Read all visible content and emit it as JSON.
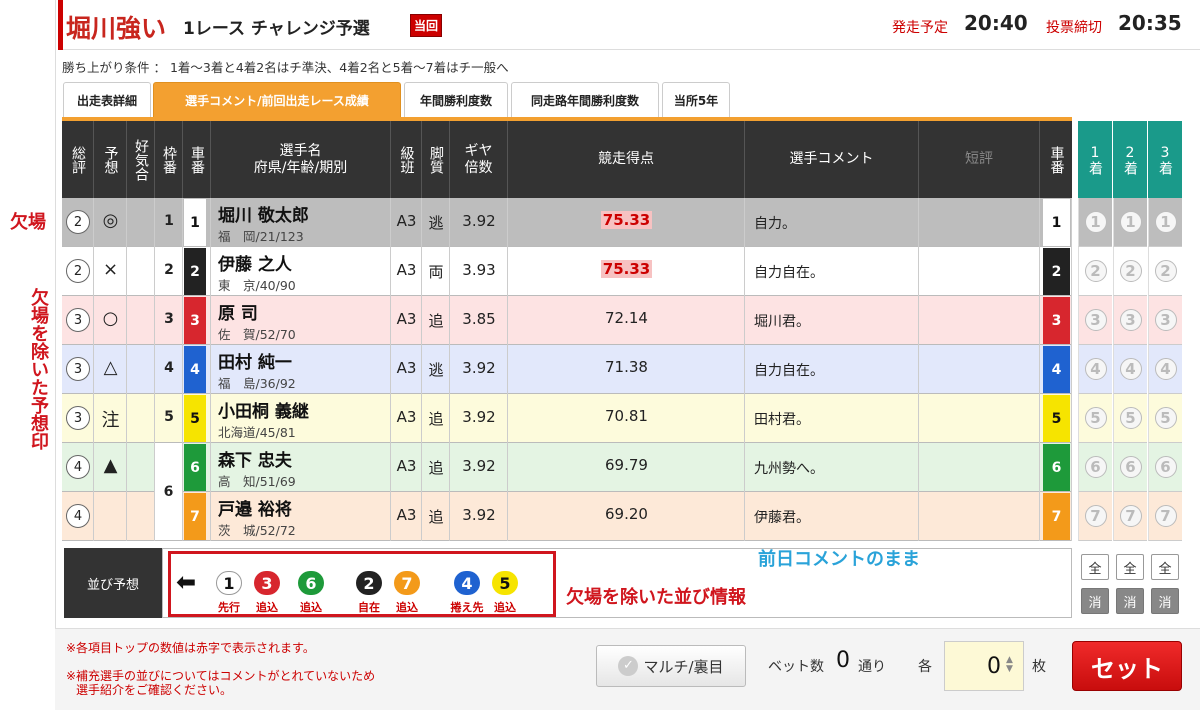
{
  "header": {
    "race_title": "堀川強い",
    "race_sub": "1レース チャレンジ予選",
    "today_badge": "当回",
    "start_label": "発走予定",
    "start_time": "20:40",
    "close_label": "投票締切",
    "close_time": "20:35"
  },
  "condition": "勝ち上がり条件 ： 1着〜3着と4着2名はチ準決、4着2名と5着〜7着はチ一般へ",
  "tabs": [
    "出走表詳細",
    "選手コメント/前回出走レース成績",
    "年間勝利度数",
    "同走路年間勝利度数",
    "当所5年"
  ],
  "columns": {
    "total": "総評",
    "yoso": "予想",
    "kouki": "好気合",
    "waku": "枠番",
    "sha": "車番",
    "name1": "選手名",
    "name2": "府県/年齢/期別",
    "kyu": "級班",
    "kyaku": "脚質",
    "gear1": "ギヤ",
    "gear2": "倍数",
    "score": "競走得点",
    "comment": "選手コメント",
    "tanpyo": "短評",
    "sha2": "車番",
    "r1": "1着",
    "r2": "2着",
    "r3": "3着"
  },
  "rows": [
    {
      "rank": "2",
      "mark": "◎",
      "waku": "1",
      "car": "1",
      "name": "堀川 敬太郎",
      "info": "福　岡/21/123",
      "cls": "A3",
      "leg": "逃",
      "gear": "3.92",
      "score": "75.33",
      "comment": "自力。"
    },
    {
      "rank": "2",
      "mark": "×",
      "waku": "2",
      "car": "2",
      "name": "伊藤 之人",
      "info": "東　京/40/90",
      "cls": "A3",
      "leg": "両",
      "gear": "3.93",
      "score": "75.33",
      "comment": "自力自在。"
    },
    {
      "rank": "3",
      "mark": "○",
      "waku": "3",
      "car": "3",
      "name": "原 司",
      "info": "佐　賀/52/70",
      "cls": "A3",
      "leg": "追",
      "gear": "3.85",
      "score": "72.14",
      "comment": "堀川君。"
    },
    {
      "rank": "3",
      "mark": "△",
      "waku": "4",
      "car": "4",
      "name": "田村 純一",
      "info": "福　島/36/92",
      "cls": "A3",
      "leg": "逃",
      "gear": "3.92",
      "score": "71.38",
      "comment": "自力自在。"
    },
    {
      "rank": "3",
      "mark": "注",
      "waku": "5",
      "car": "5",
      "name": "小田桐 義継",
      "info": "北海道/45/81",
      "cls": "A3",
      "leg": "追",
      "gear": "3.92",
      "score": "70.81",
      "comment": "田村君。"
    },
    {
      "rank": "4",
      "mark": "▲",
      "waku": "6",
      "car": "6",
      "name": "森下 忠夫",
      "info": "高　知/51/69",
      "cls": "A3",
      "leg": "追",
      "gear": "3.92",
      "score": "69.79",
      "comment": "九州勢へ。"
    },
    {
      "rank": "4",
      "mark": "",
      "waku": "",
      "car": "7",
      "name": "戸邉 裕将",
      "info": "茨　城/52/72",
      "cls": "A3",
      "leg": "追",
      "gear": "3.92",
      "score": "69.20",
      "comment": "伊藤君。"
    }
  ],
  "narabi": {
    "label": "並び予想",
    "items": [
      {
        "num": "1",
        "lbl": "先行"
      },
      {
        "num": "3",
        "lbl": "追込"
      },
      {
        "num": "6",
        "lbl": "追込"
      },
      {
        "num": "2",
        "lbl": "自在"
      },
      {
        "num": "7",
        "lbl": "追込"
      },
      {
        "num": "4",
        "lbl": "捲え先"
      },
      {
        "num": "5",
        "lbl": "追込"
      }
    ]
  },
  "all_label": "全",
  "clear_label": "消",
  "footer": {
    "note1": "※各項目トップの数値は赤字で表示されます。",
    "note2": "※補充選手の並びについてはコメントがとれていないため",
    "note3": "選手紹介をご確認ください。",
    "multi": "マルチ/裏目",
    "bet_label": "ベット数",
    "bet_count": "0",
    "bet_unit": "通り",
    "each": "各",
    "amount": "0",
    "amount_unit": "枚",
    "set": "セット"
  },
  "annotations": {
    "kekjo": "欠場",
    "kekjo_vertical": "欠場を除いた予想印",
    "comment_note": "前日コメントのまま",
    "narabi_note": "欠場を除いた並び情報"
  },
  "colors": {
    "car1": "#ffffff",
    "car2": "#222222",
    "car3": "#d7262e",
    "car4": "#1f62d0",
    "car5": "#f6e400",
    "car6": "#1e9a3a",
    "car7": "#f39a1a",
    "row1": "#bdbdbd",
    "row2": "#ffffff",
    "row3": "#fde3e3",
    "row4": "#e2e8fb",
    "row5": "#fdfbdc",
    "row6": "#e4f4e3",
    "row7": "#fde9d8"
  }
}
